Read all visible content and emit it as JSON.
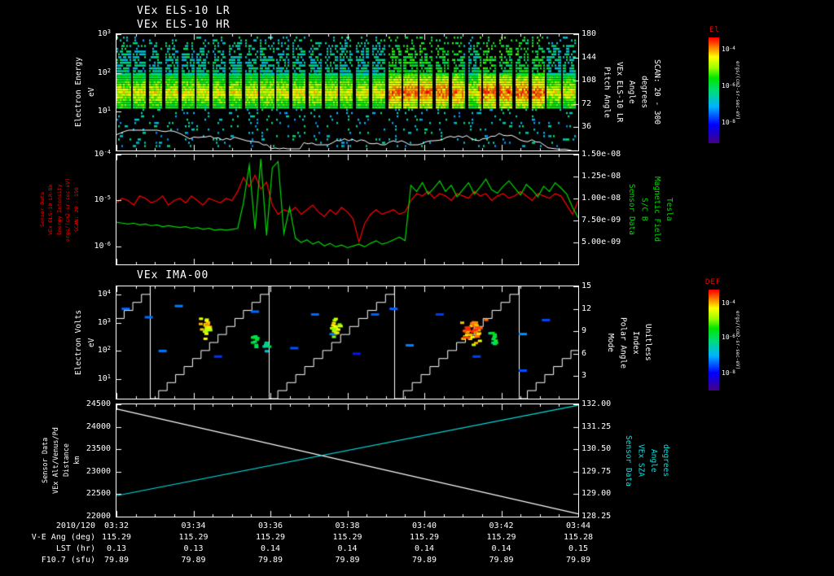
{
  "seed": 11,
  "page": {
    "bg": "#000000"
  },
  "colors": {
    "accent_red": "#ff0000",
    "trace_green": "#00d800",
    "label_cyan": "#00e0e0",
    "axis_white": "#ffffff"
  },
  "time_axis": {
    "prefix": "2010/120",
    "ticks": [
      "03:32",
      "03:34",
      "03:36",
      "03:38",
      "03:40",
      "03:42",
      "03:44"
    ]
  },
  "footer": {
    "rows": [
      {
        "label": "V-E Ang (deg)",
        "values": [
          "115.29",
          "115.29",
          "115.29",
          "115.29",
          "115.29",
          "115.29",
          "115.28"
        ]
      },
      {
        "label": "LST (hr)",
        "values": [
          "0.13",
          "0.13",
          "0.14",
          "0.14",
          "0.14",
          "0.14",
          "0.15"
        ]
      },
      {
        "label": "F10.7 (sfu)",
        "values": [
          "79.89",
          "79.89",
          "79.89",
          "79.89",
          "79.89",
          "79.89",
          "79.89"
        ]
      }
    ]
  },
  "colorbars": [
    {
      "title": "El",
      "units": "ergs/(cm2-sr-sec-eV)",
      "ticks": [
        "10^-4",
        "10^-6",
        "10^-8"
      ],
      "tick_fracs": [
        0.11,
        0.45,
        0.8
      ]
    },
    {
      "title": "DEF",
      "units": "ergs/(cm2-sr-sec-eV)",
      "ticks": [
        "10^-4",
        "10^-6",
        "10^-8"
      ],
      "tick_fracs": [
        0.13,
        0.47,
        0.82
      ]
    }
  ],
  "chart_data": [
    {
      "type": "heatmap",
      "name": "els_pitch_angle_spectrogram",
      "titles": [
        "VEx ELS-10 LR",
        "VEx ELS-10 HR"
      ],
      "ylabel_lines": [
        "Electron Energy",
        "eV"
      ],
      "yaxis": {
        "scale": "log",
        "top": 3.0,
        "bottom": 0.0,
        "ticks": [
          {
            "label": "10^3",
            "v": 3
          },
          {
            "label": "10^2",
            "v": 2
          },
          {
            "label": "10^1",
            "v": 1
          }
        ]
      },
      "right_axis": {
        "label_lines": [
          "Pitch Angle",
          "VEx ELS-10 LR",
          "Angle",
          "degrees",
          "SCAN: 20 - 300"
        ],
        "top": 180,
        "bottom": 0,
        "ticks": [
          {
            "label": "180",
            "v": 180
          },
          {
            "label": "144",
            "v": 144
          },
          {
            "label": "108",
            "v": 108
          },
          {
            "label": "72",
            "v": 72
          },
          {
            "label": "36",
            "v": 36
          }
        ]
      },
      "x_ticks": [
        "03:32",
        "03:34",
        "03:36",
        "03:38",
        "03:40",
        "03:42",
        "03:44"
      ],
      "features": {
        "segment_count": 29,
        "main_band_log_ev": [
          1.12,
          1.98
        ],
        "diffuse_log_ev": [
          1.98,
          2.92
        ],
        "sparse_low_log_ev": [
          0.12,
          1.12
        ],
        "bright_intervals": [
          [
            0.58,
            0.75
          ],
          [
            0.78,
            0.93
          ]
        ],
        "overlay_line": "spacecraft potential trace"
      }
    },
    {
      "type": "line",
      "name": "els_intensity_and_magnetic_field",
      "left_axis": {
        "scale": "log",
        "top": -4,
        "bottom": -6.39,
        "label_lines": [
          "Sensor Data",
          "VEx ELS-10 LR-Bk",
          "Energy Intensity",
          "ergs/(cm2-sr-sec-eV)",
          "SCAN: 20 - 150"
        ],
        "ticks": [
          {
            "label": "10^-4",
            "v": -4
          },
          {
            "label": "10^-5",
            "v": -5
          },
          {
            "label": "10^-6",
            "v": -6
          }
        ]
      },
      "right_axis": {
        "scale": "linear",
        "unit_scale": 1e-09,
        "top": 15,
        "bottom": 2.5,
        "label_lines": [
          "Sensor Data",
          "S/C B",
          "Magnetic Field",
          "Tesla"
        ],
        "ticks": [
          {
            "label": "1.50e-08",
            "v": 15
          },
          {
            "label": "1.25e-08",
            "v": 12.5
          },
          {
            "label": "1.00e-08",
            "v": 10
          },
          {
            "label": "7.50e-09",
            "v": 7.5
          },
          {
            "label": "5.00e-09",
            "v": 5
          }
        ]
      },
      "series": [
        {
          "name": "els_energy_intensity_log10",
          "color": "#ff0000",
          "axis": "left",
          "values": [
            -5.05,
            -4.95,
            -5.0,
            -5.1,
            -4.9,
            -4.95,
            -5.05,
            -5.0,
            -4.9,
            -5.1,
            -5.0,
            -4.95,
            -5.05,
            -4.9,
            -5.0,
            -5.1,
            -4.95,
            -5.0,
            -5.05,
            -4.95,
            -5.0,
            -4.8,
            -4.5,
            -4.7,
            -4.45,
            -4.75,
            -4.6,
            -5.1,
            -5.3,
            -5.2,
            -5.25,
            -5.15,
            -5.3,
            -5.2,
            -5.1,
            -5.25,
            -5.35,
            -5.2,
            -5.3,
            -5.15,
            -5.25,
            -5.4,
            -5.9,
            -5.5,
            -5.3,
            -5.2,
            -5.3,
            -5.25,
            -5.2,
            -5.3,
            -5.25,
            -5.0,
            -4.85,
            -4.9,
            -4.8,
            -4.95,
            -4.85,
            -4.9,
            -5.0,
            -4.85,
            -4.9,
            -4.95,
            -4.8,
            -4.9,
            -4.85,
            -5.0,
            -4.9,
            -4.85,
            -4.95,
            -4.9,
            -4.8,
            -4.9,
            -5.0,
            -4.85,
            -4.9,
            -4.95,
            -4.85,
            -4.9,
            -5.1,
            -5.3,
            -5.0
          ]
        },
        {
          "name": "sc_b_field_1e-9_tesla",
          "color": "#00d800",
          "axis": "right",
          "values": [
            7.3,
            7.2,
            7.1,
            7.2,
            7.0,
            7.1,
            6.9,
            7.0,
            6.8,
            6.9,
            6.8,
            6.7,
            6.8,
            6.6,
            6.7,
            6.5,
            6.6,
            6.4,
            6.5,
            6.4,
            6.5,
            6.6,
            9.5,
            13.8,
            6.5,
            14.5,
            5.8,
            13.5,
            14.2,
            6.0,
            9.0,
            5.5,
            5.0,
            5.3,
            4.8,
            5.1,
            4.6,
            4.9,
            4.5,
            4.7,
            4.4,
            4.6,
            4.8,
            4.5,
            4.9,
            5.2,
            4.8,
            5.0,
            5.3,
            5.6,
            5.2,
            11.5,
            10.8,
            11.8,
            10.5,
            11.2,
            12.0,
            10.8,
            11.5,
            10.2,
            11.0,
            11.8,
            10.5,
            11.3,
            12.2,
            11.0,
            10.6,
            11.4,
            12.0,
            11.2,
            10.4,
            11.6,
            11.0,
            10.2,
            11.4,
            10.8,
            11.8,
            11.2,
            10.5,
            9.0,
            7.8
          ]
        }
      ]
    },
    {
      "type": "heatmap",
      "name": "ima_spectrogram",
      "title": "VEx IMA-00",
      "ylabel_lines": [
        "Electron Volts",
        "eV"
      ],
      "yaxis": {
        "scale": "log",
        "top": 4.3,
        "bottom": 0.3,
        "ticks": [
          {
            "label": "10^4",
            "v": 4
          },
          {
            "label": "10^3",
            "v": 3
          },
          {
            "label": "10^2",
            "v": 2
          },
          {
            "label": "10^1",
            "v": 1
          }
        ]
      },
      "right_axis": {
        "label_lines": [
          "Mode",
          "Polar Angle",
          "Index",
          "Unitless"
        ],
        "top": 15,
        "bottom": 0,
        "ticks": [
          {
            "label": "15",
            "v": 15
          },
          {
            "label": "12",
            "v": 12
          },
          {
            "label": "9",
            "v": 9
          },
          {
            "label": "6",
            "v": 6
          },
          {
            "label": "3",
            "v": 3
          }
        ]
      },
      "staircase": {
        "boundaries": [
          0.073,
          0.33,
          0.602,
          0.871
        ],
        "segments": [
          [
            -0.19,
            0.073
          ],
          [
            0.073,
            0.33
          ],
          [
            0.33,
            0.602
          ],
          [
            0.602,
            0.871
          ],
          [
            0.871,
            1.135
          ]
        ],
        "steps": 14
      },
      "blobs": [
        {
          "t": 0.195,
          "log_e": 2.9,
          "spread_t": 0.014,
          "spread_log": 0.33,
          "peak": 0.85,
          "n": 26
        },
        {
          "t": 0.3,
          "log_e": 2.45,
          "spread_t": 0.008,
          "spread_log": 0.28,
          "peak": 0.55,
          "n": 10
        },
        {
          "t": 0.325,
          "log_e": 2.15,
          "spread_t": 0.006,
          "spread_log": 0.22,
          "peak": 0.5,
          "n": 8
        },
        {
          "t": 0.475,
          "log_e": 2.8,
          "spread_t": 0.012,
          "spread_log": 0.33,
          "peak": 0.8,
          "n": 18
        },
        {
          "t": 0.77,
          "log_e": 2.7,
          "spread_t": 0.024,
          "spread_log": 0.38,
          "peak": 0.92,
          "n": 48
        },
        {
          "t": 0.815,
          "log_e": 2.45,
          "spread_t": 0.01,
          "spread_log": 0.28,
          "peak": 0.6,
          "n": 12
        }
      ],
      "dashes": [
        [
          0.02,
          3.5
        ],
        [
          0.07,
          3.2
        ],
        [
          0.1,
          2.0
        ],
        [
          0.135,
          3.6
        ],
        [
          0.22,
          1.8
        ],
        [
          0.3,
          3.4
        ],
        [
          0.385,
          2.1
        ],
        [
          0.43,
          3.3
        ],
        [
          0.52,
          1.9
        ],
        [
          0.6,
          3.5
        ],
        [
          0.635,
          2.2
        ],
        [
          0.7,
          3.3
        ],
        [
          0.78,
          1.8
        ],
        [
          0.88,
          2.6
        ],
        [
          0.93,
          3.1
        ],
        [
          0.88,
          1.3
        ],
        [
          0.56,
          3.3
        ],
        [
          0.47,
          2.6
        ]
      ]
    },
    {
      "type": "line",
      "name": "altitude_and_sza",
      "left_axis": {
        "scale": "linear",
        "top": 24500,
        "bottom": 22000,
        "label_lines": [
          "Sensor Data",
          "VEx Alt/Venus/Pd",
          "Distance",
          "km"
        ],
        "ticks": [
          {
            "label": "24500",
            "v": 24500
          },
          {
            "label": "24000",
            "v": 24000
          },
          {
            "label": "23500",
            "v": 23500
          },
          {
            "label": "23000",
            "v": 23000
          },
          {
            "label": "22500",
            "v": 22500
          },
          {
            "label": "22000",
            "v": 22000
          }
        ]
      },
      "right_axis": {
        "scale": "linear",
        "top": 132.0,
        "bottom": 128.25,
        "label_lines": [
          "Sensor Data",
          "VEx SZA",
          "Angle",
          "degrees"
        ],
        "ticks": [
          {
            "label": "132.00",
            "v": 132
          },
          {
            "label": "131.25",
            "v": 131.25
          },
          {
            "label": "130.50",
            "v": 130.5
          },
          {
            "label": "129.75",
            "v": 129.75
          },
          {
            "label": "129.00",
            "v": 129
          },
          {
            "label": "128.25",
            "v": 128.25
          }
        ]
      },
      "series": [
        {
          "name": "altitude_km",
          "color": "#ffffff",
          "axis": "left",
          "points": [
            [
              0,
              24400
            ],
            [
              1,
              22060
            ]
          ]
        },
        {
          "name": "solar_zenith_angle_deg",
          "color": "#00e0e0",
          "axis": "right",
          "points": [
            [
              0,
              128.95
            ],
            [
              1,
              131.97
            ]
          ]
        }
      ]
    }
  ]
}
